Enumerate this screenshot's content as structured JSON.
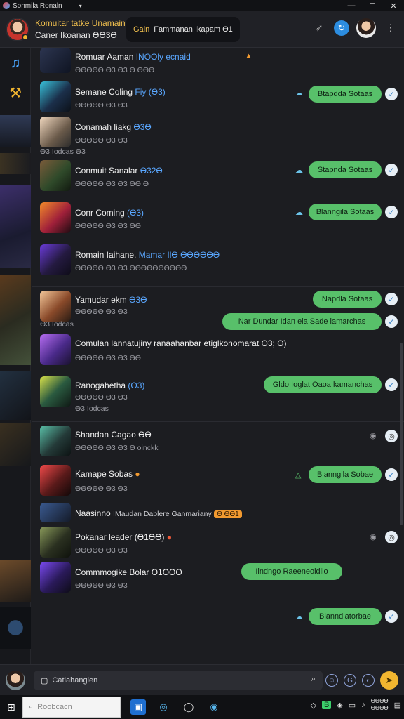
{
  "window": {
    "title": "Sonmila Ronaln",
    "minimize": "—",
    "maximize": "☐",
    "close": "✕"
  },
  "header": {
    "title": "Komuitar tatke Unamain",
    "subtitle": "Caner Ikoanan ӨӨ3Ө",
    "chip_key": "Gain",
    "chip_text": "Fammanan Ikapam Ө1"
  },
  "feed": {
    "rows": [
      {
        "title": "Romuar Aaman",
        "title_extra": "INOOly ecnaid",
        "meta": "ӨӨӨӨӨ Ө3 Ө3 Ө ӨӨӨ"
      },
      {
        "title": "Semane Coling",
        "title_extra": "Fiy (Ө3)",
        "meta": "ӨӨӨӨӨ Ө3 Ө3",
        "pill": "Btapdda Sotaas"
      },
      {
        "title": "Conamah liakg",
        "title_extra": "Ө3Ө",
        "meta": "ӨӨӨӨӨ Ө3 Ө3",
        "meta2": "Ө3 Iodcas Ө3"
      },
      {
        "title": "Conmuit Sanalar",
        "title_extra": "Ө32Ө",
        "meta": "ӨӨӨӨӨ Ө3 Ө3 ӨӨ Ө",
        "pill": "Stapnda Sotaas"
      },
      {
        "title": "Conr Coming",
        "title_extra": "(Ө3)",
        "meta": "ӨӨӨӨӨ Ө3 Ө3 ӨӨ",
        "pill": "Blanngila Sotaas"
      },
      {
        "title": "Romain Iaihane.",
        "title_extra": "Mamar IlӨ ӨӨӨӨӨӨ",
        "meta": "ӨӨӨӨӨ Ө3 Ө3 ӨӨӨӨӨӨӨӨӨӨ"
      },
      {
        "title": "Yamudar ekm",
        "title_extra": "Ө3Ө",
        "meta": "ӨӨӨӨӨ Ө3 Ө3",
        "meta2": "Ө3 Iodcas",
        "pill": "Napdla Sotaas",
        "pill2": "Nar Dundar Idan ela Sade lamarchas"
      },
      {
        "title": "Comulan lannatujiny ranaahanbar",
        "title_extra": "etiglkonomarat Ө3; Ө)",
        "meta": "ӨӨӨӨӨ Ө3 Ө3 ӨӨ"
      },
      {
        "title": "Ranogahetha",
        "title_extra": "(Ө3)",
        "meta": "ӨӨӨӨӨ Ө3 Ө3",
        "meta2": "Ө3 Iodcas",
        "pill": "Gldo Ioglat Oaoa kamanchas"
      },
      {
        "title": "Shandan Cagao",
        "title_extra": "ӨӨ",
        "meta": "ӨӨӨӨӨ Ө3 Ө3 Ө oinckk"
      },
      {
        "title": "Kamape Sobas",
        "title_extra": "",
        "meta": "ӨӨӨӨӨ Ө3 Ө3",
        "pill": "Blanngila Sobae"
      },
      {
        "title": "Naasinno",
        "title_extra": "IMaudan Dablere Ganmariany",
        "badge": "Ө ӨӨ1",
        "meta": ""
      },
      {
        "title": "Pokanar leader",
        "title_extra": "(Ө1ӨӨ)",
        "meta": "ӨӨӨӨӨ Ө3 Ө3"
      },
      {
        "title": "Commmogike Bolar",
        "title_extra": "Ө1ӨӨӨ",
        "meta": "ӨӨӨӨӨ Ө3 Ө3",
        "pill": "Ilndngo Raeeneoidiio"
      },
      {
        "title": "",
        "title_extra": "",
        "meta": "",
        "pill": "Blanndlatorbae"
      }
    ]
  },
  "composer": {
    "placeholder": "Catiahanglen"
  },
  "taskbar": {
    "search_placeholder": "Roobcacn",
    "clock_line1": "ӨӨӨӨ",
    "clock_line2": "ӨӨӨӨ"
  },
  "colors": {
    "accent_green": "#58c06a",
    "accent_gold": "#f2c14e",
    "accent_blue": "#5aa7ff"
  }
}
